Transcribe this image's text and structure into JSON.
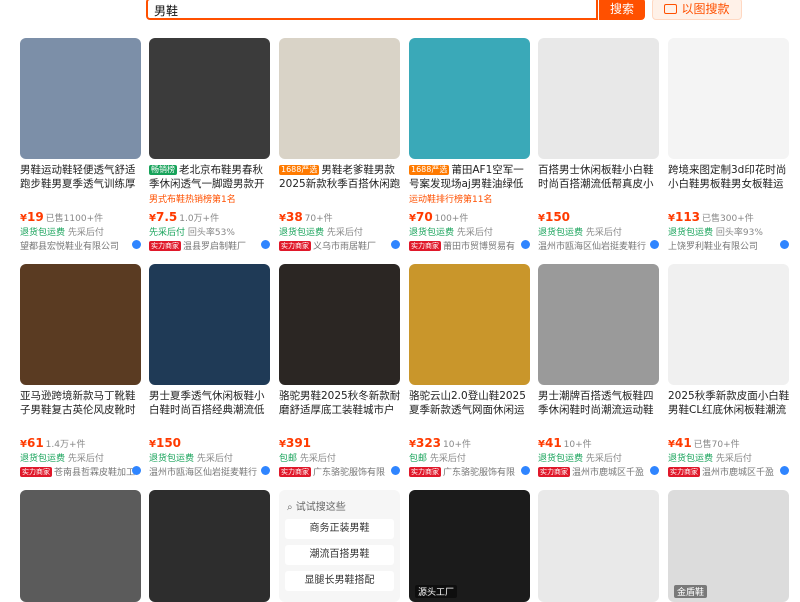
{
  "search": {
    "query": "男鞋",
    "button_label": "搜索",
    "image_search_label": "以图搜款"
  },
  "products": [
    {
      "title": "男鞋运动鞋轻便透气舒适跑步鞋男夏季透气训练厚底户",
      "price": "19",
      "sold": "已售1100+件",
      "ship_a": "退货包运费",
      "ship_b": "先采后付",
      "shop": "望都县宏悦鞋业有限公司",
      "has_badge": false,
      "tag": "",
      "sub": "",
      "img": "#7c8fa8"
    },
    {
      "title": "老北京布鞋男春秋季休闲透气一脚蹬男款开车工",
      "price": "7.5",
      "sold": "1.0万+件",
      "ship_a": "先采后付",
      "ship_b": "回头率53%",
      "shop": "温县罗启制鞋厂",
      "has_badge": true,
      "tag": "green",
      "tag_text": "畅销榜",
      "sub": "男式布鞋热销榜第1名",
      "img": "#3b3b3b"
    },
    {
      "title": "男鞋老爹鞋男款2025新款秋季百搭休闲跑步鞋",
      "price": "38",
      "sold": "70+件",
      "ship_a": "退货包运费",
      "ship_b": "先采后付",
      "shop": "义乌市雨居鞋厂",
      "has_badge": true,
      "tag": "orange",
      "tag_text": "1688严选",
      "sub": "",
      "img": "#d9d3c7"
    },
    {
      "title": "莆田AF1空军一号案发现场aj男鞋油绿低帮运动",
      "price": "70",
      "sold": "100+件",
      "ship_a": "退货包运费",
      "ship_b": "先采后付",
      "shop": "莆田市贸博贸易有",
      "has_badge": true,
      "tag": "orange",
      "tag_text": "1688严选",
      "sub": "运动鞋排行榜第11名",
      "img": "#3aa9b8"
    },
    {
      "title": "百搭男士休闲板鞋小白鞋时尚百搭潮流低帮真皮小白鞋",
      "price": "150",
      "sold": "",
      "ship_a": "退货包运费",
      "ship_b": "先采后付",
      "shop": "温州市瓯海区仙岩挺麦鞋行",
      "has_badge": false,
      "tag": "",
      "sub": "",
      "img": "#e8e8e8"
    },
    {
      "title": "跨境来图定制3d印花时尚小白鞋男板鞋男女板鞋运动",
      "price": "113",
      "sold": "已售300+件",
      "ship_a": "退货包运费",
      "ship_b": "回头率93%",
      "shop": "上饶罗利鞋业有限公司",
      "has_badge": false,
      "tag": "",
      "sub": "",
      "img": "#f4f4f4"
    },
    {
      "title": "亚马逊跨境新款马丁靴鞋子男鞋复古英伦风皮靴时尚高",
      "price": "61",
      "sold": "1.4万+件",
      "ship_a": "退货包运费",
      "ship_b": "先采后付",
      "shop": "苍南县哲霖皮鞋加工",
      "has_badge": true,
      "tag": "",
      "sub": "",
      "img": "#5a3b22"
    },
    {
      "title": "男士夏季透气休闲板鞋小白鞋时尚百搭经典潮流低帮真",
      "price": "150",
      "sold": "",
      "ship_a": "退货包运费",
      "ship_b": "先采后付",
      "shop": "温州市瓯海区仙岩挺麦鞋行",
      "has_badge": false,
      "tag": "",
      "sub": "",
      "img": "#1f3a56"
    },
    {
      "title": "骆驼男鞋2025秋冬新款耐磨舒适厚底工装鞋城市户外复",
      "price": "391",
      "sold": "",
      "ship_a": "包邮",
      "ship_b": "先采后付",
      "shop": "广东骆驼服饰有限",
      "has_badge": true,
      "tag": "",
      "sub": "",
      "img": "#2b2623"
    },
    {
      "title": "骆驼云山2.0登山鞋2025夏季新款透气网面休闲运动鞋",
      "price": "323",
      "sold": "10+件",
      "ship_a": "包邮",
      "ship_b": "先采后付",
      "shop": "广东骆驼服饰有限",
      "has_badge": true,
      "tag": "",
      "sub": "",
      "img": "#c9962b"
    },
    {
      "title": "男士潮牌百搭透气板鞋四季休闲鞋时尚潮流运动鞋男皮",
      "price": "41",
      "sold": "10+件",
      "ship_a": "退货包运费",
      "ship_b": "先采后付",
      "shop": "温州市鹿城区千盈",
      "has_badge": true,
      "tag": "",
      "sub": "",
      "img": "#9a9a9a"
    },
    {
      "title": "2025秋季新款皮面小白鞋男鞋CL红底休闲板鞋潮流通",
      "price": "41",
      "sold": "已售70+件",
      "ship_a": "退货包运费",
      "ship_b": "先采后付",
      "shop": "温州市鹿城区千盈",
      "has_badge": true,
      "tag": "",
      "sub": "",
      "img": "#f0f0f0"
    }
  ],
  "row3": [
    {
      "img": "#5b5b5b"
    },
    {
      "img": "#2d2d2d"
    },
    {
      "suggest": true,
      "head": "试试搜这些",
      "chips": [
        "商务正装男鞋",
        "潮流百搭男鞋",
        "显腿长男鞋搭配"
      ]
    },
    {
      "img": "#1b1b1b",
      "label": "源头工厂"
    },
    {
      "img": "#e9e9e9"
    },
    {
      "img": "#dcdcdc",
      "label": "金盾鞋"
    }
  ]
}
